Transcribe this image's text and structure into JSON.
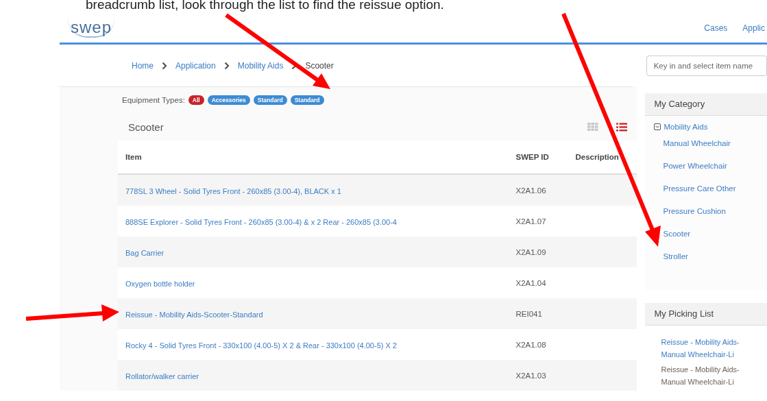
{
  "caption": "breadcrumb list, look through the list to find the reissue option.",
  "header": {
    "logo": "swep",
    "nav": [
      {
        "label": "Cases"
      },
      {
        "label": "Applic"
      }
    ]
  },
  "breadcrumb": [
    {
      "label": "Home",
      "current": false
    },
    {
      "label": "Application",
      "current": false
    },
    {
      "label": "Mobility Aids",
      "current": false
    },
    {
      "label": "Scooter",
      "current": true
    }
  ],
  "search": {
    "placeholder": "Key in and select item name"
  },
  "equipment_types": {
    "label": "Equipment Types:",
    "tags": [
      {
        "label": "All",
        "selected": true
      },
      {
        "label": "Accessories",
        "selected": false
      },
      {
        "label": "Standard",
        "selected": false
      },
      {
        "label": "Standard",
        "selected": false
      }
    ]
  },
  "panel": {
    "title": "Scooter",
    "view_toggle": [
      {
        "kind": "grid",
        "selected": false
      },
      {
        "kind": "list",
        "selected": true
      }
    ]
  },
  "table": {
    "columns": [
      "Item",
      "SWEP ID",
      "Description"
    ],
    "rows": [
      {
        "item": "778SL 3 Wheel - Solid Tyres Front - 260x85 (3.00-4), BLACK x 1",
        "swep_id": "X2A1.06"
      },
      {
        "item": "888SE Explorer - Solid Tyres Front - 260x85 (3.00-4) & x 2 Rear - 260x85 (3.00-4",
        "swep_id": "X2A1.07"
      },
      {
        "item": "Bag Carrier",
        "swep_id": "X2A1.09"
      },
      {
        "item": "Oxygen bottle holder",
        "swep_id": "X2A1.04"
      },
      {
        "item": "Reissue - Mobility Aids-Scooter-Standard",
        "swep_id": "REI041"
      },
      {
        "item": "Rocky 4 - Solid Tyres Front - 330x100 (4.00-5) X 2 & Rear - 330x100 (4.00-5) X 2",
        "swep_id": "X2A1.08"
      },
      {
        "item": "Rollator/walker carrier",
        "swep_id": "X2A1.03"
      }
    ]
  },
  "sidebar": {
    "category": {
      "title": "My Category",
      "tree": [
        {
          "label": "Mobility Aids",
          "expanded": true,
          "children": [
            {
              "label": "Manual Wheelchair"
            },
            {
              "label": "Power Wheelchair"
            },
            {
              "label": "Pressure Care Other"
            },
            {
              "label": "Pressure Cushion"
            },
            {
              "label": "Scooter"
            },
            {
              "label": "Stroller"
            }
          ]
        }
      ]
    },
    "picking_list": {
      "title": "My Picking List",
      "items": [
        {
          "label": "Reissue - Mobility Aids-Manual Wheelchair-Li",
          "selected": false
        },
        {
          "label": "Reissue - Mobility Aids-Manual Wheelchair-Li",
          "selected": true
        }
      ]
    }
  }
}
